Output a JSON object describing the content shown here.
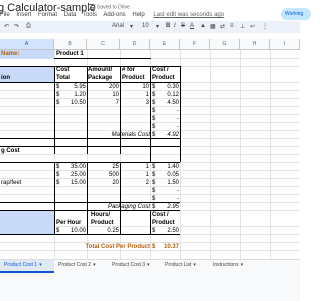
{
  "doc": {
    "title": "g Calculator-sample",
    "saved": "Saved to Drive",
    "menus": [
      "File",
      "Insert",
      "Format",
      "Data",
      "Tools",
      "Add-ons",
      "Help"
    ],
    "last_edit": "Last edit was seconds ago",
    "working": "Working"
  },
  "toolbar": {
    "font": "Arial",
    "size": "10"
  },
  "columns": [
    "A",
    "B",
    "C",
    "D",
    "E",
    "F",
    "G",
    "H",
    "I",
    "J"
  ],
  "sheet": {
    "name_label": "Name:",
    "product_name": "Product 1",
    "header": {
      "col_b_label": "ion",
      "cost1": "Cost",
      "cost2": "Total",
      "amount1": "Amount/",
      "amount2": "Package",
      "num1": "# for",
      "num2": "Product",
      "costp1": "Cost /",
      "costp2": "Product"
    },
    "materials": [
      {
        "sym": "$",
        "cost": "5.95",
        "amount": "200",
        "num": "10",
        "sym2": "$",
        "costp": "0.30"
      },
      {
        "sym": "$",
        "cost": "1.20",
        "amount": "10",
        "num": "1",
        "sym2": "$",
        "costp": "0.12"
      },
      {
        "sym": "$",
        "cost": "10.50",
        "amount": "7",
        "num": "3",
        "sym2": "$",
        "costp": "4.50"
      },
      {
        "sym": "",
        "cost": "",
        "amount": "",
        "num": "",
        "sym2": "$",
        "costp": "-"
      },
      {
        "sym": "",
        "cost": "",
        "amount": "",
        "num": "",
        "sym2": "$",
        "costp": "-"
      },
      {
        "sym": "",
        "cost": "",
        "amount": "",
        "num": "",
        "sym2": "$",
        "costp": "-"
      }
    ],
    "materials_total_label": "Materials Cost",
    "materials_total": {
      "sym": "$",
      "value": "4.92"
    },
    "packaging_label": "g Cost",
    "packaging": [
      {
        "name": "",
        "sym": "$",
        "cost": "35.00",
        "amount": "25",
        "num": "1",
        "sym2": "$",
        "costp": "1.40"
      },
      {
        "name": "",
        "sym": "$",
        "cost": "25.00",
        "amount": "500",
        "num": "1",
        "sym2": "$",
        "costp": "0.05"
      },
      {
        "name": "rap/feet",
        "sym": "$",
        "cost": "15.00",
        "amount": "20",
        "num": "2",
        "sym2": "$",
        "costp": "1.50"
      },
      {
        "name": "",
        "sym": "",
        "cost": "",
        "amount": "",
        "num": "",
        "sym2": "$",
        "costp": "-"
      },
      {
        "name": "",
        "sym": "",
        "cost": "",
        "amount": "",
        "num": "",
        "sym2": "$",
        "costp": "-"
      }
    ],
    "packaging_total_label": "Packaging Cost",
    "packaging_total": {
      "sym": "$",
      "value": "2.95"
    },
    "labor": {
      "hours1": "Hours/",
      "hours2": "Product",
      "per_hour": "Per Hour",
      "costp1": "Cost /",
      "costp2": "Product",
      "sym": "$",
      "rate": "10.00",
      "hours": "0.25",
      "sym2": "$",
      "cost": "2.50"
    },
    "total_label": "Total Cost Per Product",
    "total": {
      "sym": "$",
      "value": "10.37"
    }
  },
  "tabs": [
    "Product Cost 1",
    "Product Cost 2",
    "Product Cost 3",
    "Product List",
    "Instructions"
  ]
}
